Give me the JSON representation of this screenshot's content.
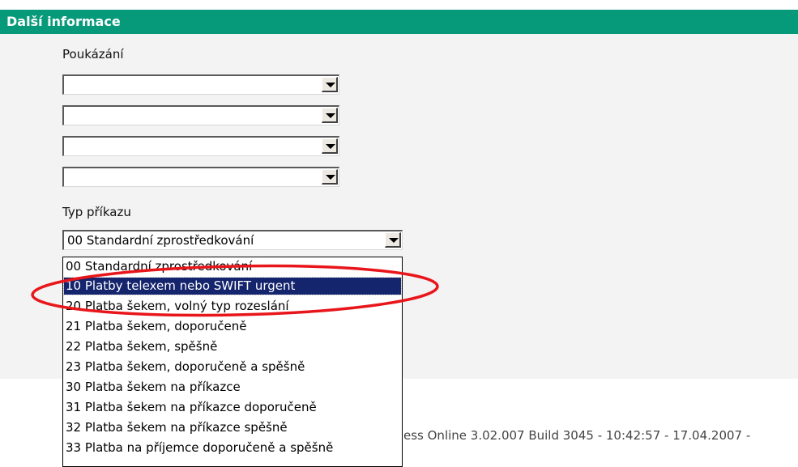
{
  "section": {
    "title": "Další informace"
  },
  "poukazani": {
    "label": "Poukázání",
    "combos": [
      {
        "value": ""
      },
      {
        "value": ""
      },
      {
        "value": ""
      },
      {
        "value": ""
      }
    ]
  },
  "typ_prikazu": {
    "label": "Typ příkazu",
    "selected": "00 Standardní zprostředkování",
    "options": [
      "00 Standardní zprostředkování",
      "10 Platby telexem nebo SWIFT urgent",
      "20 Platba šekem, volný typ rozeslání",
      "21 Platba šekem, doporučeně",
      "22 Platba šekem, spěšně",
      "23 Platba šekem, doporučeně a spěšně",
      "30 Platba šekem na příkazce",
      "31 Platba šekem na příkazce doporučeně",
      "32 Platba šekem na příkazce spěšně",
      "33 Platba na příjemce doporučeně a spěšně"
    ],
    "highlighted_index": 1
  },
  "footer": {
    "text": "ess Online 3.02.007 Build 3045 - 10:42:57 - 17.04.2007 -"
  },
  "colors": {
    "header": "#079a7a",
    "selection": "#14246d",
    "annotation": "#e8161b"
  }
}
